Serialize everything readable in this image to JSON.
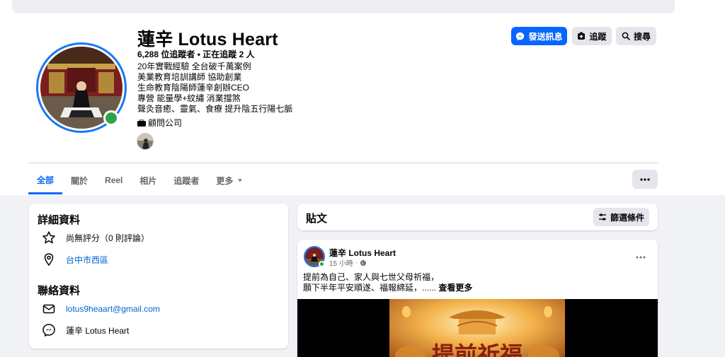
{
  "profile": {
    "name": "蓮辛 Lotus Heart",
    "followers_line": "6,288 位追蹤者 • 正在追蹤 2 人",
    "bio": [
      "20年實戰經驗 全台破千萬案例",
      "美業教育培訓講師 協助創業",
      "生命教育陰陽師蓮辛創辦CEO",
      "專營 能量學+紋繡 消業擋煞",
      "聲灸音癒、靈氣、食療 提升陰五行陽七脈"
    ],
    "category": "顧問公司"
  },
  "actions": {
    "message": "發送訊息",
    "follow": "追蹤",
    "search": "搜尋"
  },
  "tabs": [
    "全部",
    "關於",
    "Reel",
    "相片",
    "追蹤者",
    "更多"
  ],
  "details": {
    "title": "詳細資料",
    "rating": "尚無評分（0 則評論）",
    "location": "台中市西區",
    "contact_title": "聯絡資料",
    "email": "lotus9heaart@gmail.com",
    "messenger": "蓮辛 Lotus Heart"
  },
  "posts": {
    "title": "貼文",
    "filter": "篩選條件",
    "item": {
      "author": "蓮辛 Lotus Heart",
      "time": "15 小時",
      "line1": "提前為自己、家人與七世父母祈福，",
      "line2": "願下半年平安順遂、福報綿延，......",
      "see_more": "查看更多",
      "image_text": "提前祈福"
    }
  },
  "colors": {
    "accent": "#0866ff",
    "online": "#31a24c",
    "link": "#0064d1"
  }
}
